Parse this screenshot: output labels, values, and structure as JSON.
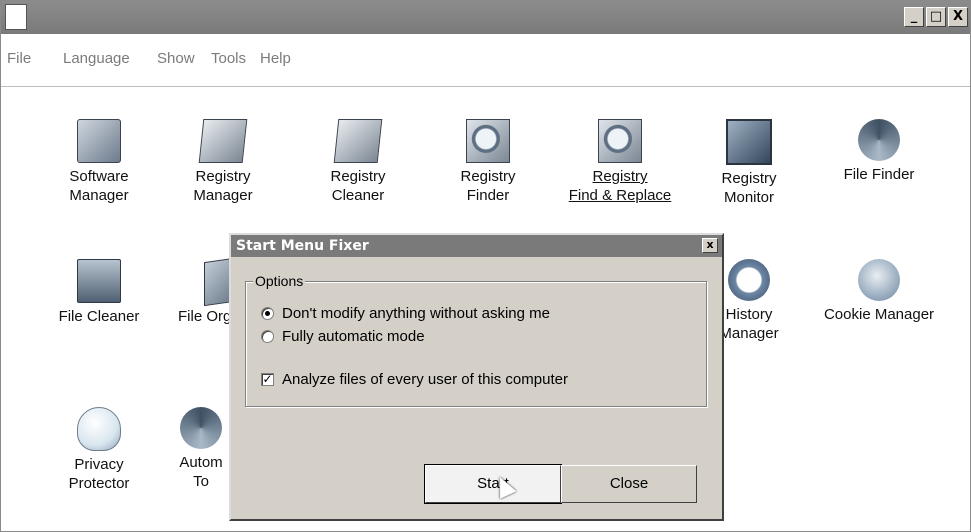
{
  "titlebar": {
    "minimize": "_",
    "maximize": "□",
    "close": "X"
  },
  "menu": [
    {
      "label": "File"
    },
    {
      "label": "Language"
    },
    {
      "label": "Show"
    },
    {
      "label": "Tools"
    },
    {
      "label": "Help"
    }
  ],
  "tools": [
    {
      "line1": "Software",
      "line2": "Manager",
      "icon": "software-manager-icon"
    },
    {
      "line1": "Registry",
      "line2": "Manager",
      "icon": "registry-manager-icon"
    },
    {
      "line1": "Registry",
      "line2": "Cleaner",
      "icon": "registry-cleaner-icon"
    },
    {
      "line1": "Registry",
      "line2": "Finder",
      "icon": "registry-finder-icon"
    },
    {
      "line1": "Registry",
      "line2": "Find & Replace",
      "icon": "registry-find-replace-icon"
    },
    {
      "line1": "Registry",
      "line2": "Monitor",
      "icon": "registry-monitor-icon"
    },
    {
      "line1": "File Finder",
      "line2": "",
      "icon": "file-finder-icon"
    },
    {
      "line1": "File Cleaner",
      "line2": "",
      "icon": "file-cleaner-icon"
    },
    {
      "line1": "File Org",
      "line2": "",
      "icon": "file-organizer-icon"
    },
    {
      "line1": "History",
      "line2": "Manager",
      "icon": "history-manager-icon"
    },
    {
      "line1": "Cookie Manager",
      "line2": "",
      "icon": "cookie-manager-icon"
    },
    {
      "line1": "Privacy",
      "line2": "Protector",
      "icon": "privacy-protector-icon"
    },
    {
      "line1": "Autom",
      "line2": "To",
      "icon": "automation-tool-icon"
    }
  ],
  "dialog": {
    "title": "Start Menu Fixer",
    "close": "x",
    "group_label": "Options",
    "option1": "Don't modify anything without asking me",
    "option2": "Fully automatic mode",
    "checkbox": "Analyze files of every user of this computer",
    "checkbox_mark": "✓",
    "start": "Start",
    "close_button": "Close"
  }
}
